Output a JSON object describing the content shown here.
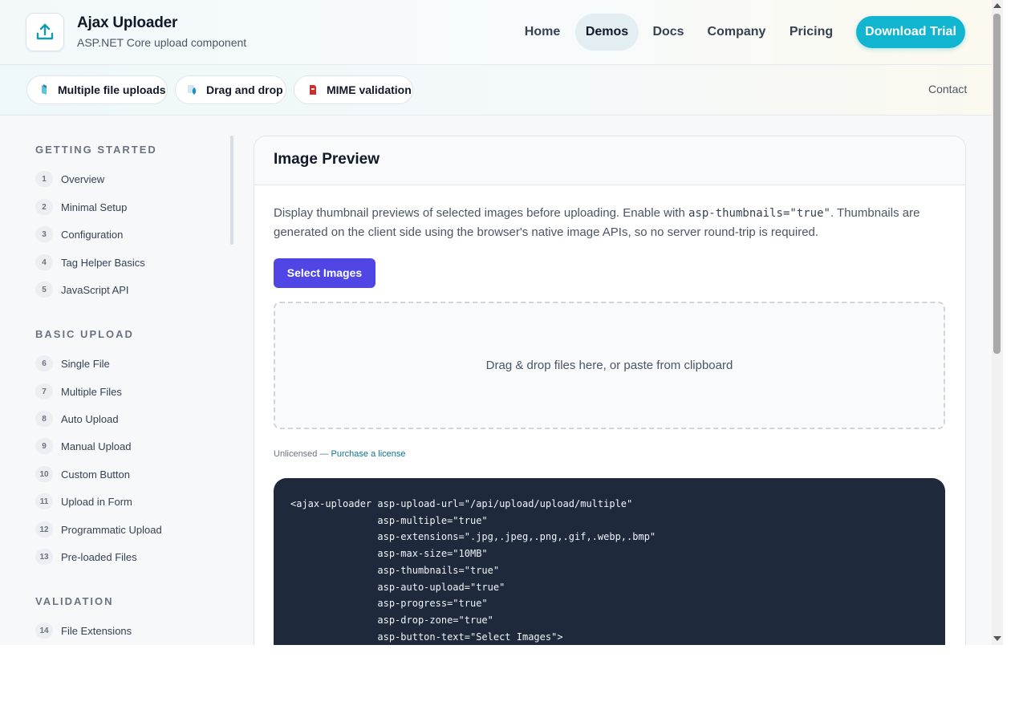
{
  "header": {
    "brand_title": "Ajax Uploader",
    "brand_subtitle": "ASP.NET Core upload component",
    "logo_icon": "upload-icon",
    "nav": [
      {
        "label": "Home",
        "active": false
      },
      {
        "label": "Demos",
        "active": true
      },
      {
        "label": "Docs",
        "active": false
      },
      {
        "label": "Company",
        "active": false
      },
      {
        "label": "Pricing",
        "active": false
      }
    ],
    "cta_label": "Download Trial"
  },
  "subbar": {
    "chips": [
      {
        "label": "Multiple file uploads",
        "icon": "files-icon"
      },
      {
        "label": "Drag and drop",
        "icon": "drag-drop-icon"
      },
      {
        "label": "MIME validation",
        "icon": "mime-icon"
      }
    ],
    "contact_label": "Contact"
  },
  "sidebar": {
    "sections": [
      {
        "title": "GETTING STARTED",
        "items": [
          {
            "num": "1",
            "label": "Overview"
          },
          {
            "num": "2",
            "label": "Minimal Setup"
          },
          {
            "num": "3",
            "label": "Configuration"
          },
          {
            "num": "4",
            "label": "Tag Helper Basics"
          },
          {
            "num": "5",
            "label": "JavaScript API"
          }
        ]
      },
      {
        "title": "BASIC UPLOAD",
        "items": [
          {
            "num": "6",
            "label": "Single File"
          },
          {
            "num": "7",
            "label": "Multiple Files"
          },
          {
            "num": "8",
            "label": "Auto Upload"
          },
          {
            "num": "9",
            "label": "Manual Upload"
          },
          {
            "num": "10",
            "label": "Custom Button"
          },
          {
            "num": "11",
            "label": "Upload in Form"
          },
          {
            "num": "12",
            "label": "Programmatic Upload"
          },
          {
            "num": "13",
            "label": "Pre-loaded Files"
          }
        ]
      },
      {
        "title": "VALIDATION",
        "items": [
          {
            "num": "14",
            "label": "File Extensions"
          }
        ]
      }
    ]
  },
  "main": {
    "title": "Image Preview",
    "desc_before": "Display thumbnail previews of selected images before uploading. Enable with ",
    "desc_code": "asp-thumbnails=\"true\"",
    "desc_after": ". Thumbnails are generated on the client side using the browser's native image APIs, so no server round-trip is required.",
    "select_button": "Select Images",
    "dropzone_text": "Drag & drop files here, or paste from clipboard",
    "license_text": "Unlicensed — ",
    "license_link": "Purchase a license",
    "code": "<ajax-uploader asp-upload-url=\"/api/upload/upload/multiple\"\n               asp-multiple=\"true\"\n               asp-extensions=\".jpg,.jpeg,.png,.gif,.webp,.bmp\"\n               asp-max-size=\"10MB\"\n               asp-thumbnails=\"true\"\n               asp-auto-upload=\"true\"\n               asp-progress=\"true\"\n               asp-drop-zone=\"true\"\n               asp-button-text=\"Select Images\">"
  },
  "colors": {
    "accent": "#11b5cf",
    "primary_button": "#4f46e5",
    "code_bg": "#1e293b"
  }
}
